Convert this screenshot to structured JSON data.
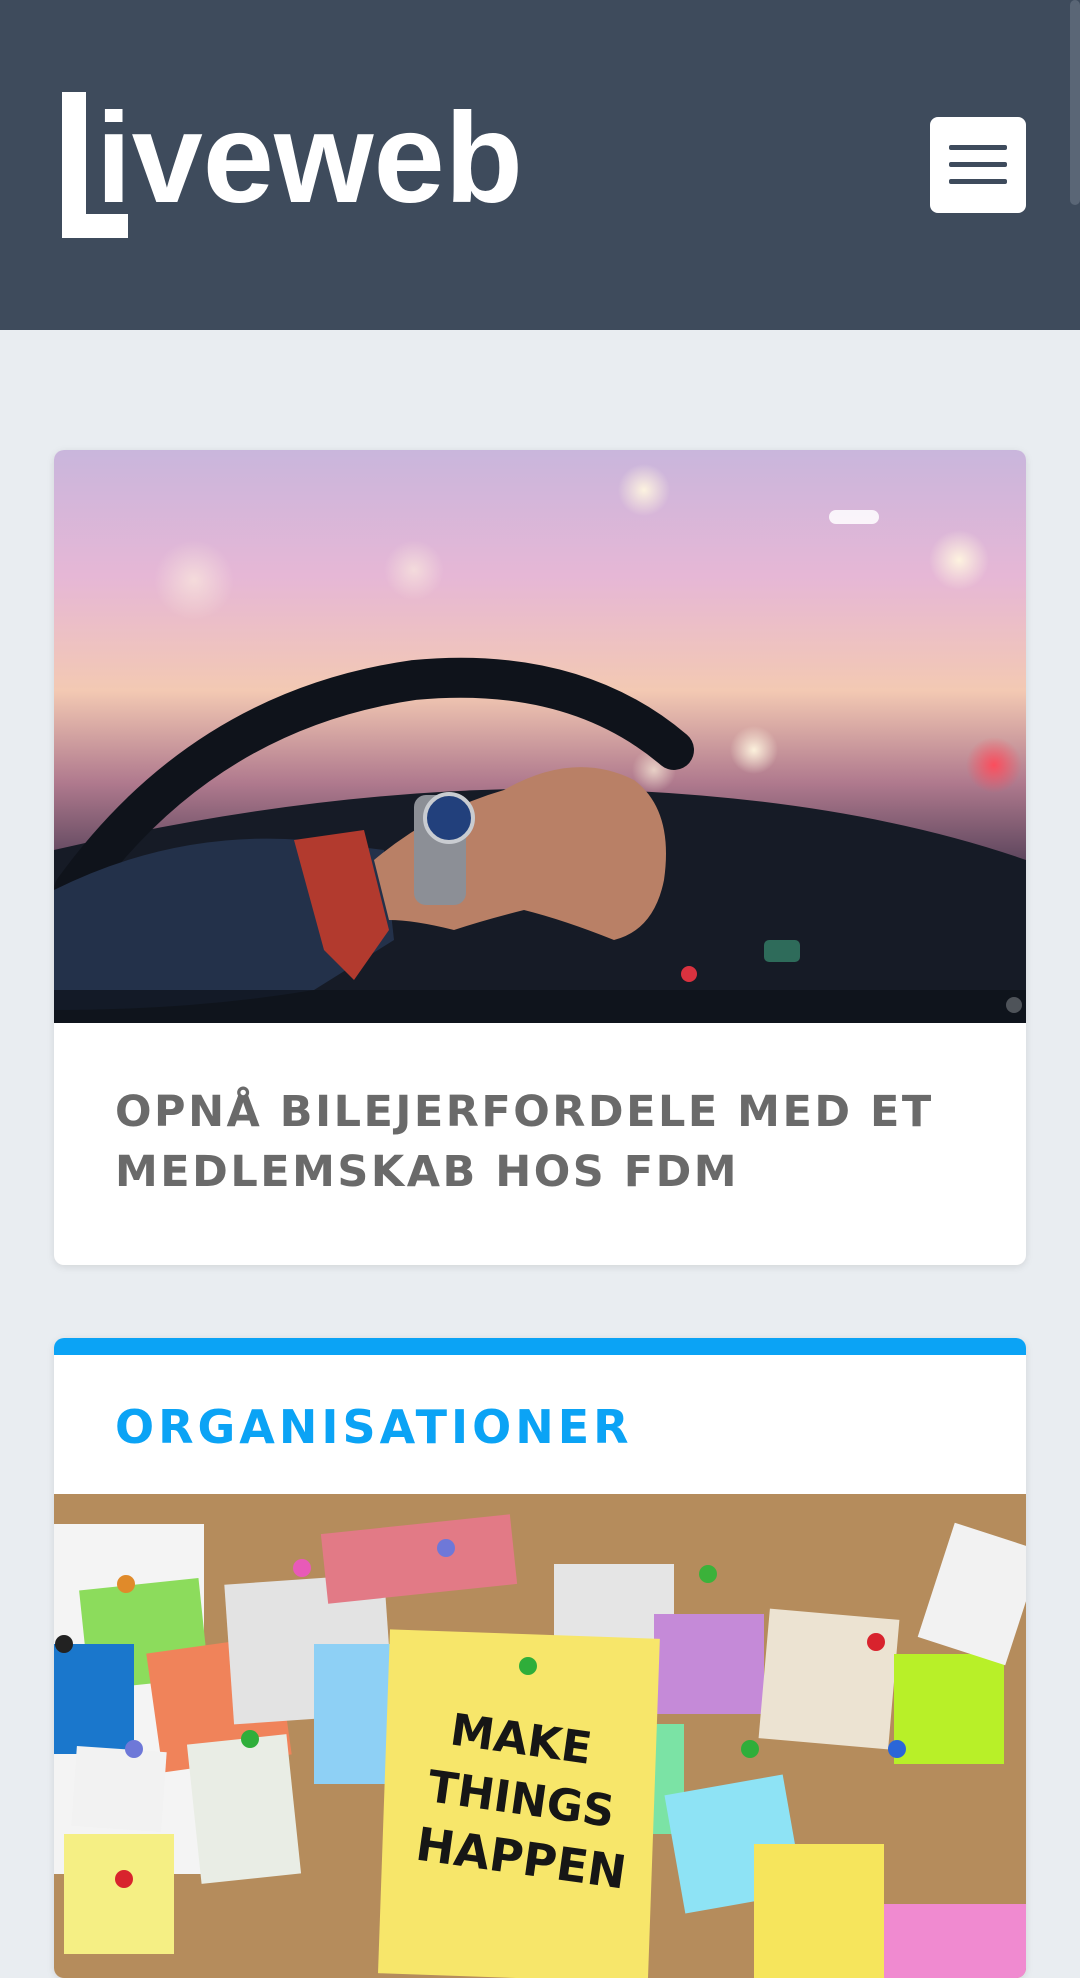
{
  "header": {
    "logo_text": "Liveweb",
    "background": "#3e4b5c",
    "menu_icon": "hamburger-menu-icon"
  },
  "posts": [
    {
      "title": "OPNÅ BILEJERFORDELE MED ET MEDLEMSKAB HOS FDM",
      "image": "car-steering-wheel-photo"
    }
  ],
  "category": {
    "title": "ORGANISATIONER",
    "accent_color": "#0ba3f5",
    "image": "pinboard-sticky-notes-photo",
    "sticky_note_text": [
      "MAKE",
      "THINGS",
      "HAPPEN"
    ]
  }
}
